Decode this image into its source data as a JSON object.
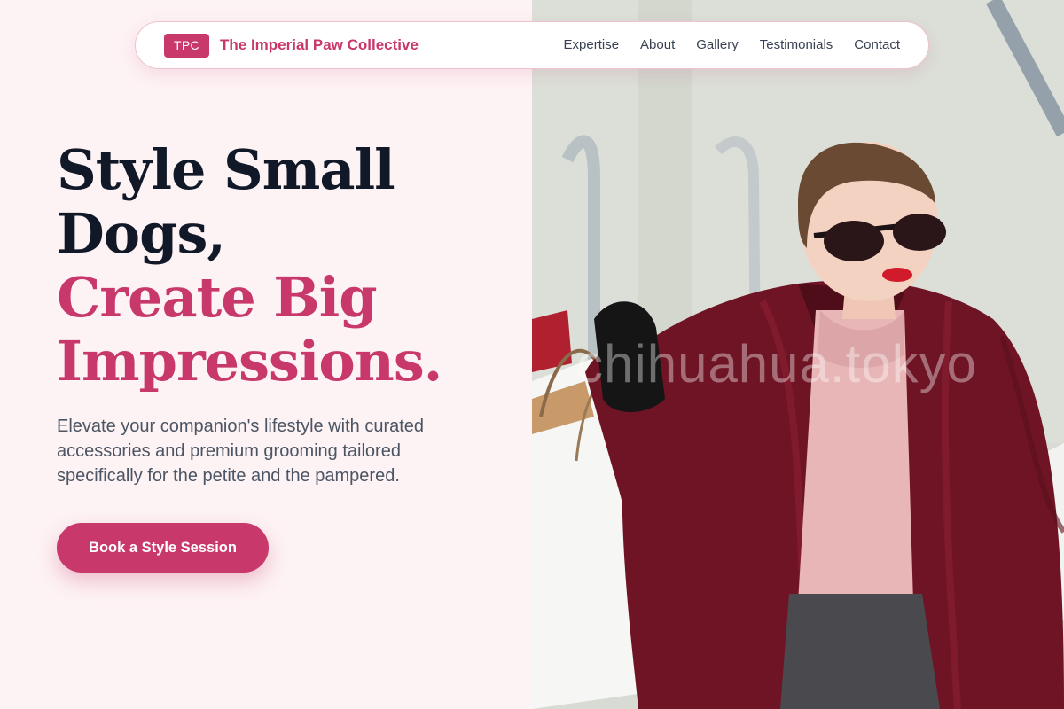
{
  "nav": {
    "brand_initials": "TPC",
    "brand_name": "The Imperial Paw Collective",
    "links": [
      "Expertise",
      "About",
      "Gallery",
      "Testimonials",
      "Contact"
    ]
  },
  "hero": {
    "headline_dark_1": "Style Small",
    "headline_dark_2": "Dogs,",
    "headline_accent_1": "Create Big",
    "headline_accent_2": "Impressions.",
    "subtext": "Elevate your companion's lifestyle with curated accessories and premium grooming tailored specifically for the petite and the pampered.",
    "cta_label": "Book a Style Session"
  },
  "photo": {
    "watermark": "chihuahua.tokyo",
    "alt_subject": "woman-with-shopping-bags"
  },
  "colors": {
    "accent": "#c8386b",
    "background": "#fdf2f4",
    "heading": "#111827",
    "body_text": "#4b5563"
  }
}
